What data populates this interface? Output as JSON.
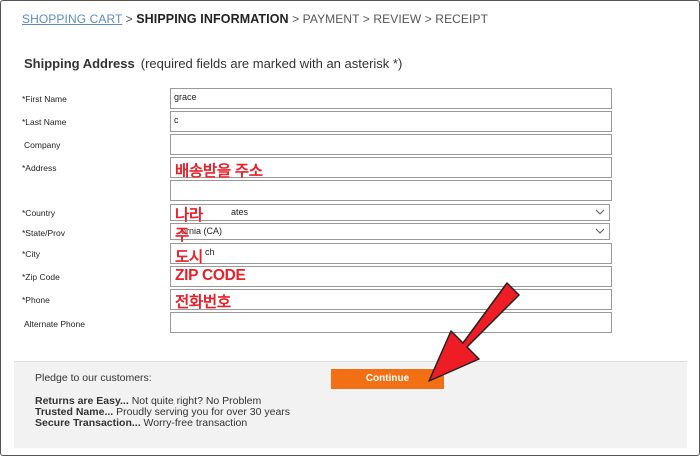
{
  "breadcrumb": {
    "step1": "SHOPPING CART",
    "sep1": " > ",
    "step2": "SHIPPING INFORMATION",
    "sep2": " > ",
    "step3": "PAYMENT",
    "sep3": " > ",
    "step4": "REVIEW",
    "sep4": " > ",
    "step5": "RECEIPT"
  },
  "section": {
    "title": "Shipping Address",
    "note": "(required fields are marked with an asterisk *)"
  },
  "form": {
    "first_name": {
      "label": "*First Name",
      "value": "grace"
    },
    "last_name": {
      "label": "*Last Name",
      "value": "c"
    },
    "company": {
      "label": "Company",
      "value": ""
    },
    "address": {
      "label": "*Address",
      "value": "",
      "value2": ""
    },
    "country": {
      "label": "*Country",
      "value": "ates"
    },
    "state": {
      "label": "*State/Prov",
      "value": "ornia (CA)"
    },
    "city": {
      "label": "*City",
      "value": "ch"
    },
    "zip": {
      "label": "*Zip Code",
      "value": ""
    },
    "phone": {
      "label": "*Phone",
      "value": ""
    },
    "alt_phone": {
      "label": "Alternate Phone",
      "value": ""
    }
  },
  "annotations": {
    "address": "배송받을 주소",
    "country": "나라",
    "state": "주",
    "city": "도시",
    "zip": "ZIP CODE",
    "phone": "전화번호"
  },
  "footer": {
    "pledge": "Pledge to our customers:",
    "continue_label": "Continue",
    "promo1_bold": "Returns are Easy...",
    "promo1_text": " Not quite right? No Problem",
    "promo2_bold": "Trusted Name...",
    "promo2_text": " Proudly serving you for over 30 years",
    "promo3_bold": "Secure Transaction...",
    "promo3_text": " Worry-free transaction"
  },
  "colors": {
    "accent": "#f36f13",
    "annotation": "#e8202a",
    "link": "#5b8dbd"
  }
}
